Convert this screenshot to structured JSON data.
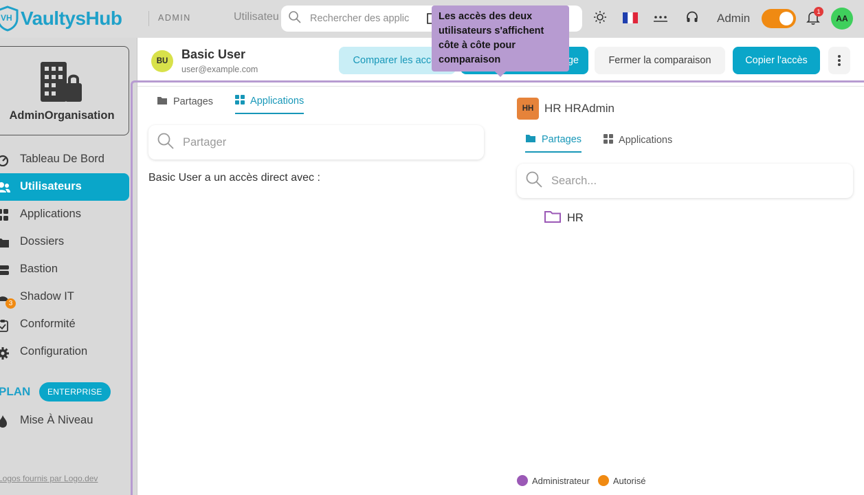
{
  "topbar": {
    "brand": "VaultysHub",
    "logo_initials": "VH",
    "section_tag": "ADMIN",
    "breadcrumb": "Utilisateu",
    "search_placeholder": "Rechercher des applic",
    "user_label": "Admin",
    "notification_count": "1",
    "avatar_initials": "AA",
    "flag": "🇫🇷"
  },
  "sidebar": {
    "org_name": "AdminOrganisation",
    "items": [
      {
        "label": "Tableau De Bord",
        "icon": "dashboard-icon"
      },
      {
        "label": "Utilisateurs",
        "icon": "users-icon",
        "active": true
      },
      {
        "label": "Applications",
        "icon": "apps-grid-icon"
      },
      {
        "label": "Dossiers",
        "icon": "folder-icon"
      },
      {
        "label": "Bastion",
        "icon": "server-icon"
      },
      {
        "label": "Shadow IT",
        "icon": "shadow-it-icon",
        "badge": "3"
      },
      {
        "label": "Conformité",
        "icon": "clipboard-check-icon"
      },
      {
        "label": "Configuration",
        "icon": "gear-icon"
      }
    ],
    "plan_label": "PLAN",
    "plan_badge": "ENTERPRISE",
    "upgrade_label": "Mise À Niveau",
    "footer_link": "Logos fournis par Logo.dev"
  },
  "header": {
    "user_initials": "BU",
    "user_name": "Basic User",
    "user_email": "user@example.com",
    "compare_button": "Comparer les accès",
    "hidden_button_fragment": "ge",
    "close_compare_button": "Fermer la comparaison",
    "copy_access_button": "Copier l'accès"
  },
  "tooltip": {
    "text": "Les accès des deux utilisateurs s'affichent côte à côte pour comparaison"
  },
  "left_panel": {
    "tabs": [
      {
        "label": "Partages",
        "icon": "folder-icon"
      },
      {
        "label": "Applications",
        "icon": "apps-grid-icon",
        "active": true
      }
    ],
    "search_placeholder": "Partager",
    "direct_access_text": "Basic User a un accès direct avec :"
  },
  "right_panel": {
    "user_initials": "HH",
    "user_name": "HR HRAdmin",
    "tabs": [
      {
        "label": "Partages",
        "icon": "folder-icon",
        "active": true
      },
      {
        "label": "Applications",
        "icon": "apps-grid-icon"
      }
    ],
    "search_placeholder": "Search...",
    "folders": [
      {
        "name": "HR"
      }
    ]
  },
  "legend": {
    "items": [
      {
        "label": "Administrateur",
        "color": "#9b59b6"
      },
      {
        "label": "Autorisé",
        "color": "#f08a12"
      }
    ]
  },
  "colors": {
    "accent": "#0aa6c9",
    "tooltip": "#b79bd1",
    "orange": "#f08a12",
    "admin_purple": "#9b59b6"
  }
}
